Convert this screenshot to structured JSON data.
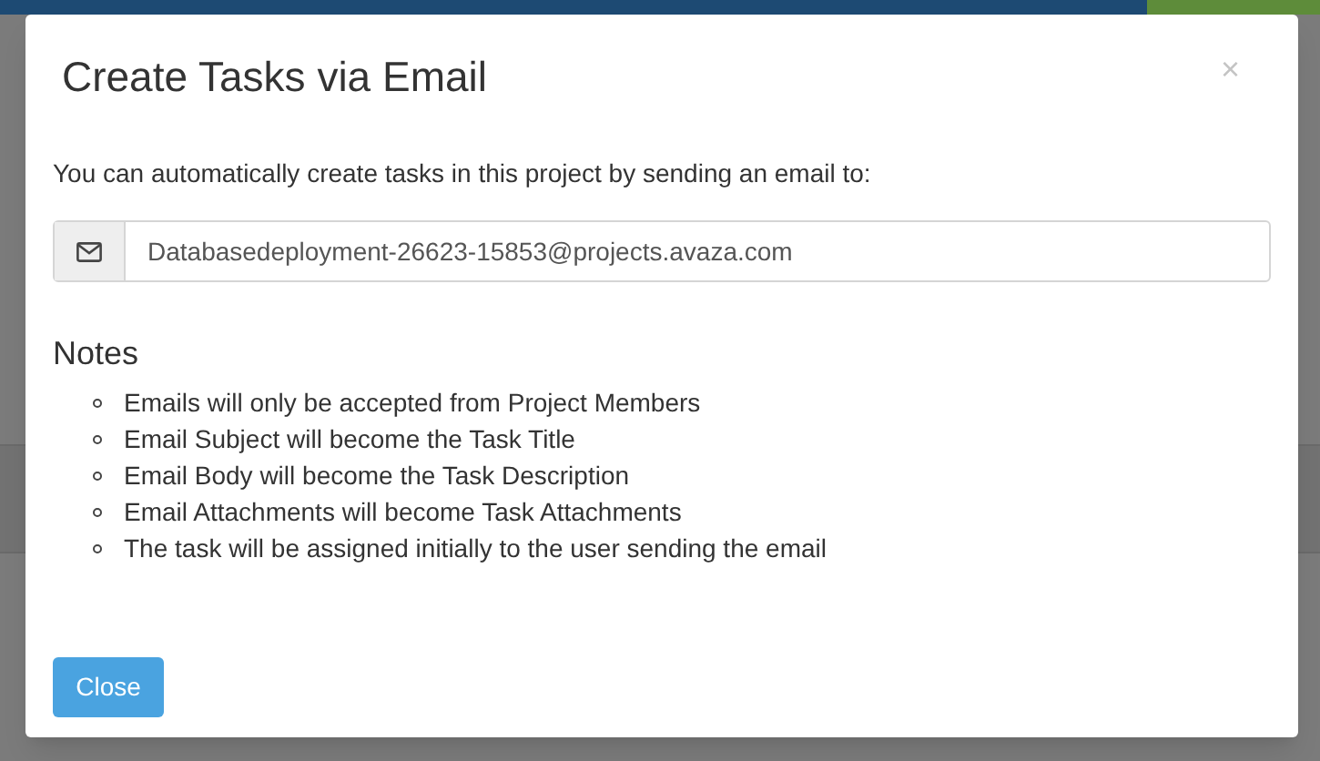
{
  "dialog": {
    "title": "Create Tasks via Email",
    "close_icon": "×",
    "intro": "You can automatically create tasks in this project by sending an email to:",
    "email_address": "Databasedeployment-26623-15853@projects.avaza.com",
    "notes_heading": "Notes",
    "notes": [
      "Emails will only be accepted from Project Members",
      "Email Subject will become the Task Title",
      "Email Body will become the Task Description",
      "Email Attachments will become Task Attachments",
      "The task will be assigned initially to the user sending the email"
    ],
    "close_button": "Close"
  }
}
